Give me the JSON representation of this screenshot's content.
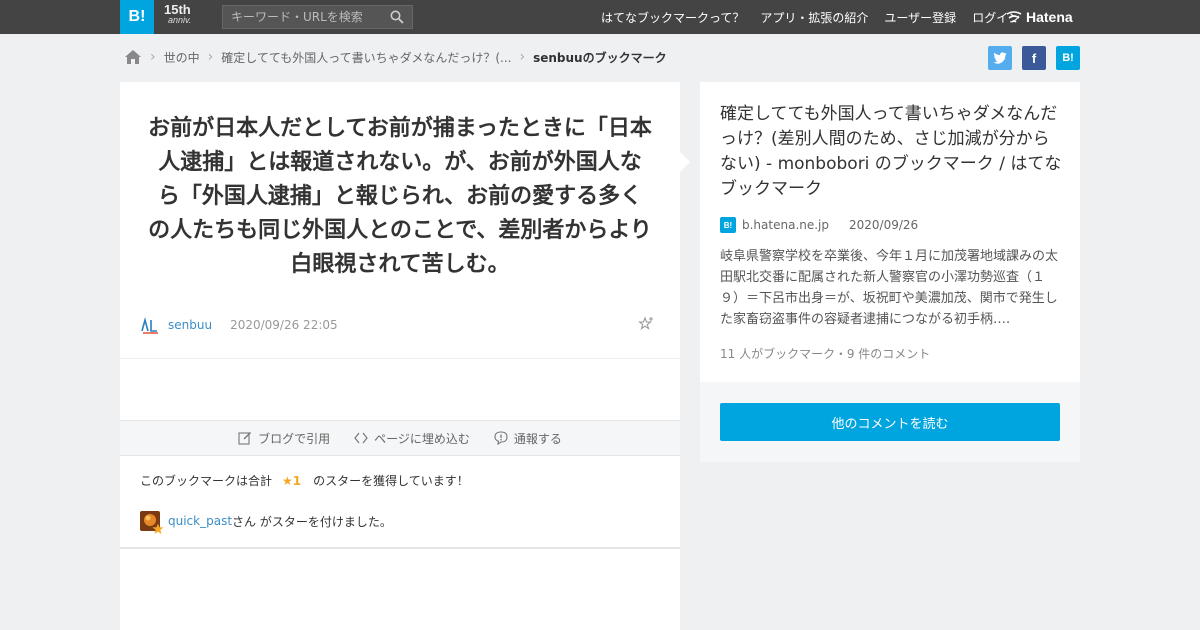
{
  "header": {
    "logo_text": "B!",
    "anniv_top": "15th",
    "anniv_bottom": "anniv.",
    "search_placeholder": "キーワード・URLを検索",
    "nav": [
      "はてなブックマークって？",
      "アプリ・拡張の紹介",
      "ユーザー登録",
      "ログイン"
    ],
    "hatena_label": "Hatena"
  },
  "breadcrumb": {
    "items": [
      "世の中",
      "確定してても外国人って書いちゃダメなんだっけ？(...",
      "senbuuのブックマーク"
    ]
  },
  "share": {
    "twitter_icon": "twitter-icon",
    "facebook_label": "f",
    "hatebu_label": "B!"
  },
  "bookmark": {
    "comment": "お前が日本人だとしてお前が捕まったときに「日本人逮捕」とは報道されない。が、お前が外国人なら「外国人逮捕」と報じられ、お前の愛する多くの人たちも同じ外国人とのことで、差別者からより白眼視されて苦しむ。",
    "user": "senbuu",
    "datetime": "2020/09/26 22:05"
  },
  "actions": {
    "quote": "ブログで引用",
    "embed": "ページに埋め込む",
    "report": "通報する"
  },
  "stars": {
    "summary_prefix": "このブックマークは合計",
    "count_label": "★1",
    "summary_suffix": "のスターを獲得しています！",
    "giver": "quick_past",
    "giver_suffix": "さん がスターを付けました。"
  },
  "entry": {
    "title": "確定してても外国人って書いちゃダメなんだっけ？(差別人間のため、さじ加減が分からない) - monbobori のブックマーク / はてなブックマーク",
    "domain": "b.hatena.ne.jp",
    "date": "2020/09/26",
    "excerpt": "岐阜県警察学校を卒業後、今年１月に加茂署地域課みの太田駅北交番に配属された新人警察官の小澤功勢巡査（１９）＝下呂市出身＝が、坂祝町や美濃加茂、関市で発生した家畜窃盗事件の容疑者逮捕につながる初手柄….",
    "counts": "11 人がブックマーク・9 件のコメント",
    "more_button": "他のコメントを読む"
  },
  "colors": {
    "accent": "#00a4de",
    "topbar": "#444444",
    "twitter": "#55acee",
    "facebook": "#3b5998",
    "star": "#f5a623"
  }
}
